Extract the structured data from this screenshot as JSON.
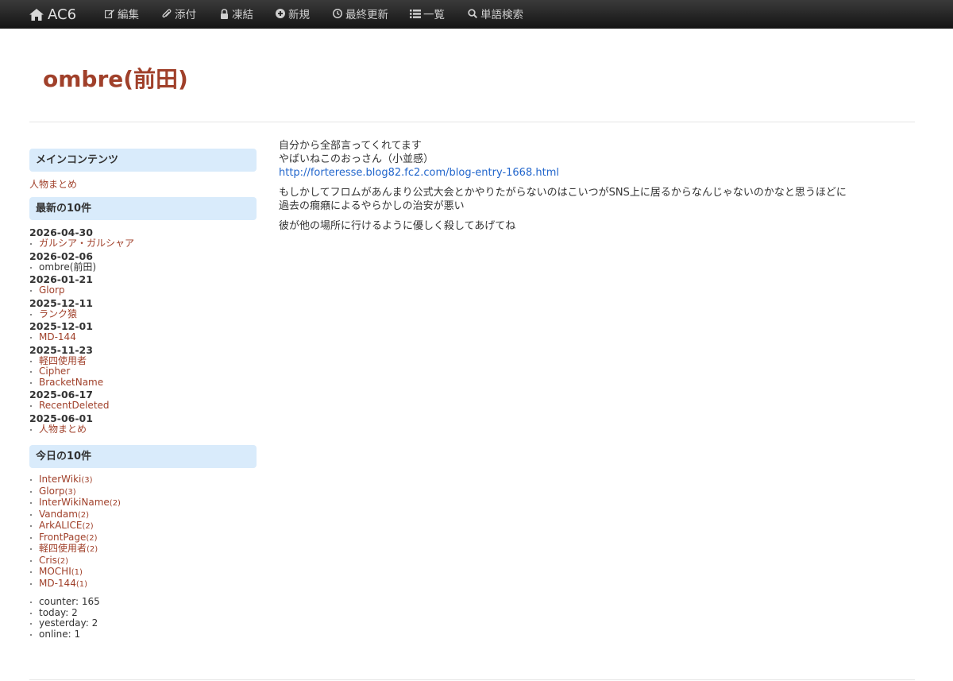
{
  "navbar": {
    "brand": "AC6",
    "items": [
      {
        "label": "編集",
        "icon": "edit-icon"
      },
      {
        "label": "添付",
        "icon": "paperclip-icon"
      },
      {
        "label": "凍結",
        "icon": "lock-icon"
      },
      {
        "label": "新規",
        "icon": "plus-circle-icon"
      },
      {
        "label": "最終更新",
        "icon": "clock-icon"
      },
      {
        "label": "一覧",
        "icon": "list-icon"
      },
      {
        "label": "単語検索",
        "icon": "search-icon"
      }
    ]
  },
  "page": {
    "title": "ombre(前田)"
  },
  "content": {
    "p1_line1": "自分から全部言ってくれてます",
    "p1_line2": "やばいねこのおっさん（小並感）",
    "p1_link": "http://forteresse.blog82.fc2.com/blog-entry-1668.html",
    "p2_line1": "もしかしてフロムがあんまり公式大会とかやりたがらないのはこいつがSNS上に居るからなんじゃないのかなと思うほどに",
    "p2_line2": "過去の癇癪によるやらかしの治安が悪い",
    "p3": "彼が他の場所に行けるように優しく殺してあげてね"
  },
  "sidebar": {
    "main_contents": {
      "heading": "メインコンテンツ",
      "link": "人物まとめ"
    },
    "recent": {
      "heading": "最新の10件",
      "groups": [
        {
          "date": "2026-04-30",
          "items": [
            "ガルシア・ガルシャア"
          ]
        },
        {
          "date": "2026-02-06",
          "items": [
            "ombre(前田)"
          ]
        },
        {
          "date": "2026-01-21",
          "items": [
            "Glorp"
          ]
        },
        {
          "date": "2025-12-11",
          "items": [
            "ランク猿"
          ]
        },
        {
          "date": "2025-12-01",
          "items": [
            "MD-144"
          ]
        },
        {
          "date": "2025-11-23",
          "items": [
            "軽四使用者",
            "Cipher",
            "BracketName"
          ]
        },
        {
          "date": "2025-06-17",
          "items": [
            "RecentDeleted"
          ]
        },
        {
          "date": "2025-06-01",
          "items": [
            "人物まとめ"
          ]
        }
      ]
    },
    "today": {
      "heading": "今日の10件",
      "items": [
        {
          "label": "InterWiki",
          "count": "(3)"
        },
        {
          "label": "Glorp",
          "count": "(3)"
        },
        {
          "label": "InterWikiName",
          "count": "(2)"
        },
        {
          "label": "Vandam",
          "count": "(2)"
        },
        {
          "label": "ArkALICE",
          "count": "(2)"
        },
        {
          "label": "FrontPage",
          "count": "(2)"
        },
        {
          "label": "軽四使用者",
          "count": "(2)"
        },
        {
          "label": "Cris",
          "count": "(2)"
        },
        {
          "label": "MOCHI",
          "count": "(1)"
        },
        {
          "label": "MD-144",
          "count": "(1)"
        }
      ]
    },
    "counter": {
      "counter": "counter: 165",
      "today": "today: 2",
      "yesterday": "yesterday: 2",
      "online": "online: 1"
    }
  },
  "colors": {
    "accent": "#a0402a",
    "link_blue": "#2266cc",
    "panel_bg": "#d9ebfb",
    "navbar_bg": "#1c1c1c"
  }
}
